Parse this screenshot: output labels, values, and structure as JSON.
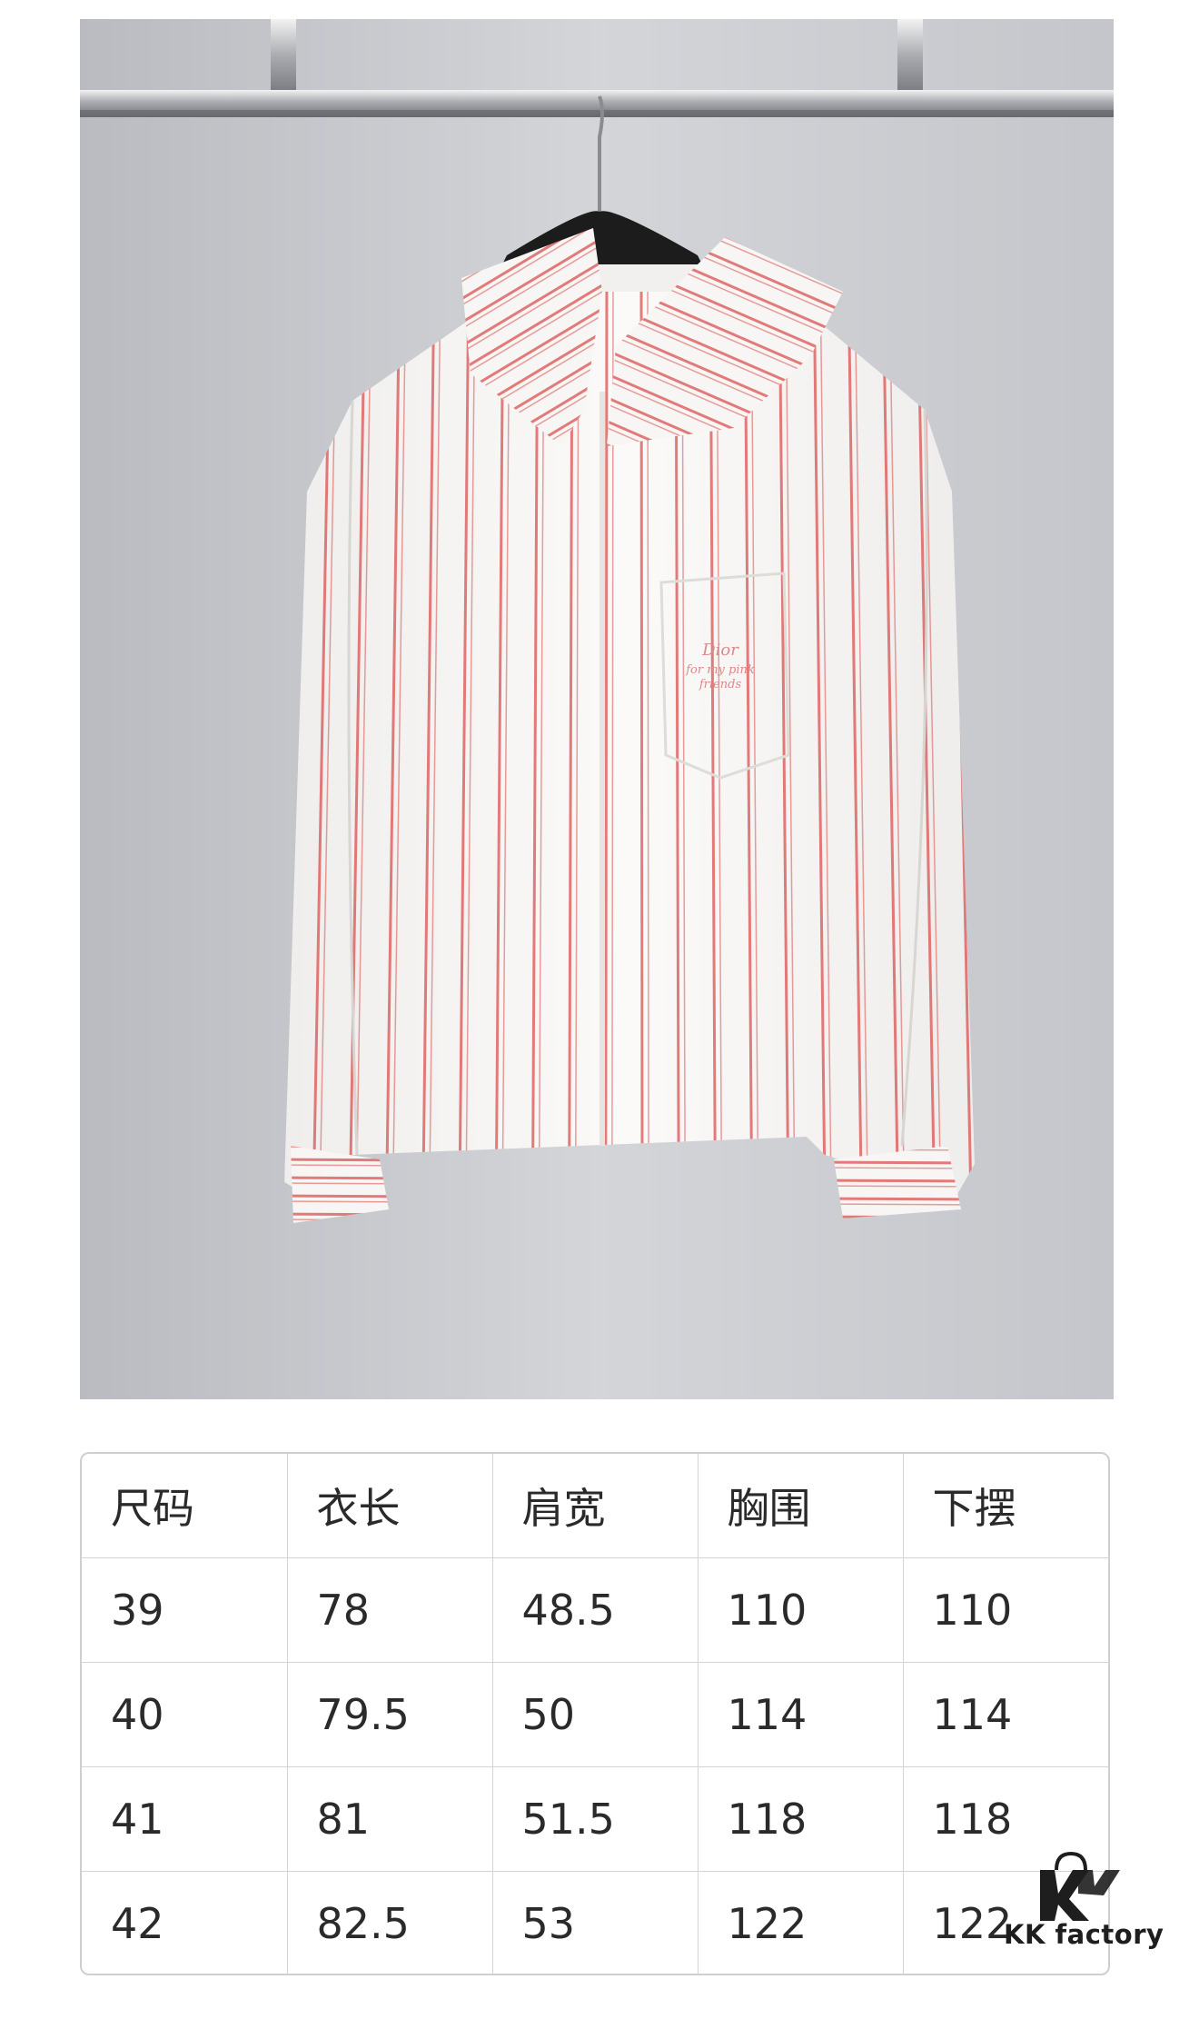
{
  "photo": {
    "embroidery_text": "Dior for my pink friends"
  },
  "size_table": {
    "headers": [
      "尺码",
      "衣长",
      "肩宽",
      "胸围",
      "下摆"
    ],
    "rows": [
      [
        "39",
        "78",
        "48.5",
        "110",
        "110"
      ],
      [
        "40",
        "79.5",
        "50",
        "114",
        "114"
      ],
      [
        "41",
        "81",
        "51.5",
        "118",
        "118"
      ],
      [
        "42",
        "82.5",
        "53",
        "122",
        "122"
      ]
    ]
  },
  "watermark": {
    "brand": "KK factory",
    "logo_letters": "K"
  }
}
